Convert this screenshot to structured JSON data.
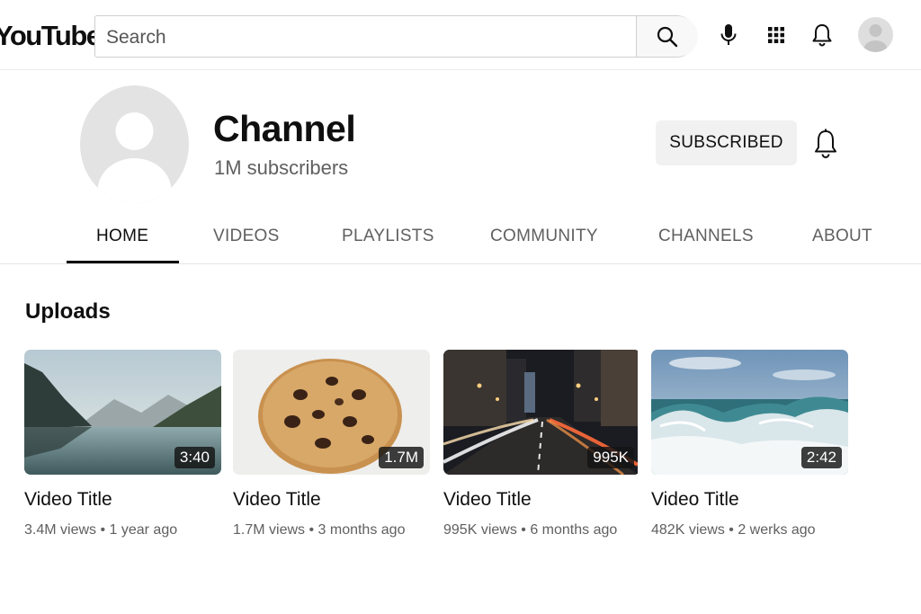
{
  "header": {
    "logo": "YouTube",
    "search": {
      "placeholder": "Search",
      "value": ""
    },
    "icons": [
      "search-icon",
      "microphone-icon",
      "apps-grid-icon",
      "notifications-bell-icon",
      "user-avatar"
    ]
  },
  "channel": {
    "name": "Channel",
    "subscribers": "1M subscribers",
    "subscribe_label": "SUBSCRIBED"
  },
  "tabs": [
    {
      "label": "HOME",
      "active": true
    },
    {
      "label": "VIDEOS",
      "active": false
    },
    {
      "label": "PLAYLISTS",
      "active": false
    },
    {
      "label": "COMMUNITY",
      "active": false
    },
    {
      "label": "CHANNELS",
      "active": false
    },
    {
      "label": "ABOUT",
      "active": false
    }
  ],
  "uploads": {
    "title": "Uploads",
    "videos": [
      {
        "title": "Video Title",
        "badge": "3:40",
        "meta": "3.4M views • 1 year ago",
        "thumb": "mountain-lake"
      },
      {
        "title": "Video Title",
        "badge": "1.7M",
        "meta": "1.7M views • 3 months ago",
        "thumb": "cookie"
      },
      {
        "title": "Video Title",
        "badge": "995K",
        "meta": "995K views • 6 months ago",
        "thumb": "city-night-street"
      },
      {
        "title": "Video Title",
        "badge": "2:42",
        "meta": "482K views • 2 werks ago",
        "thumb": "ocean-wave"
      }
    ]
  },
  "colors": {
    "text_primary": "#0f0f0f",
    "text_secondary": "#606060",
    "button_bg": "#f1f1f1",
    "border": "#cfcfcf"
  }
}
